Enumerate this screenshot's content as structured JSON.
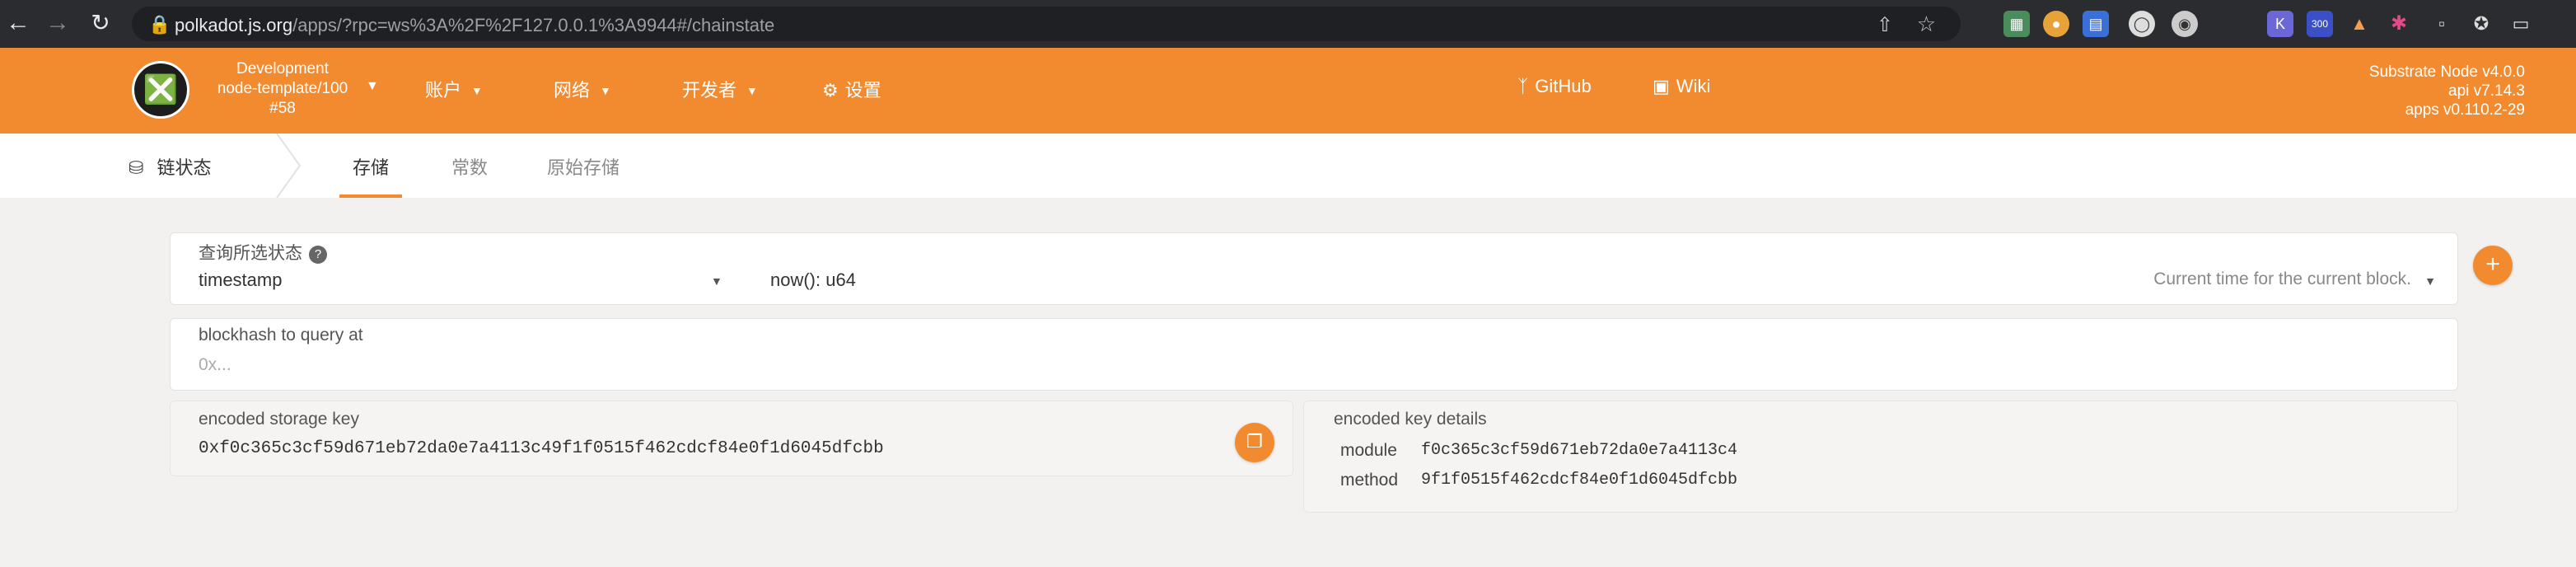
{
  "browser": {
    "url_host": "polkadot.js.org",
    "url_path": "/apps/?rpc=ws%3A%2F%2F127.0.0.1%3A9944#/chainstate",
    "back_icon": "arrow-left-icon",
    "forward_icon": "arrow-right-icon",
    "reload_icon": "reload-icon",
    "extension_k_label": "K",
    "extension_num_label": "300"
  },
  "header": {
    "chain_type": "Development",
    "chain_name": "node-template/100",
    "block": "#58",
    "menu": {
      "accounts": "账户",
      "network": "网络",
      "developer": "开发者",
      "settings": "设置",
      "github": "GitHub",
      "wiki": "Wiki"
    },
    "version": {
      "node": "Substrate Node v4.0.0",
      "api": "api v7.14.3",
      "apps": "apps v0.110.2-29"
    }
  },
  "subnav": {
    "section": "链状态",
    "tabs": [
      "存储",
      "常数",
      "原始存储"
    ]
  },
  "query": {
    "label": "查询所选状态",
    "module": "timestamp",
    "method": "now(): u64",
    "description": "Current time for the current block."
  },
  "blockhash": {
    "label": "blockhash to query at",
    "placeholder": "0x..."
  },
  "encoded_key": {
    "label": "encoded storage key",
    "value": "0xf0c365c3cf59d671eb72da0e7a4113c49f1f0515f462cdcf84e0f1d6045dfcbb"
  },
  "key_details": {
    "label": "encoded key details",
    "module_label": "module",
    "module_value": "f0c365c3cf59d671eb72da0e7a4113c4",
    "method_label": "method",
    "method_value": "9f1f0515f462cdcf84e0f1d6045dfcbb"
  },
  "colors": {
    "accent": "#f28b30",
    "chrome": "#2b2c30",
    "background": "#f2f1ef"
  }
}
